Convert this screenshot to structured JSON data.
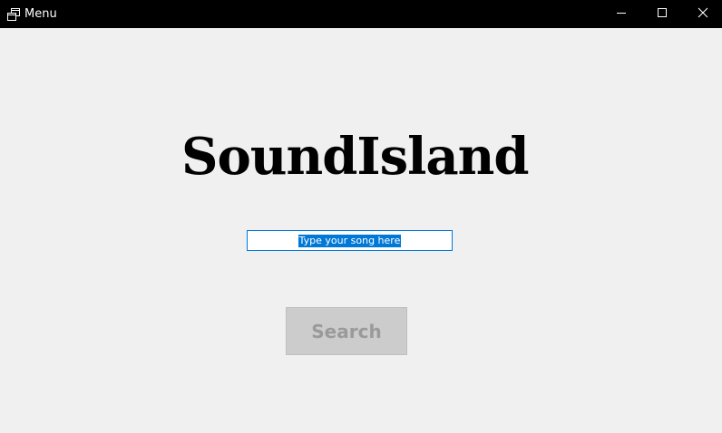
{
  "window": {
    "title": "Menu",
    "icon": "window-menu-icon",
    "controls": {
      "minimize_icon": "minimize-icon",
      "maximize_icon": "maximize-icon",
      "close_icon": "close-icon"
    }
  },
  "main": {
    "brand_title": "SoundIsland",
    "search": {
      "value": "Type your song here",
      "selected": true
    },
    "search_button_label": "Search",
    "search_button_enabled": false
  },
  "colors": {
    "titlebar_bg": "#000000",
    "content_bg": "#f0f0f0",
    "selection": "#0078d7",
    "button_disabled_bg": "#cccccc",
    "button_disabled_text": "#9a9a9a"
  }
}
